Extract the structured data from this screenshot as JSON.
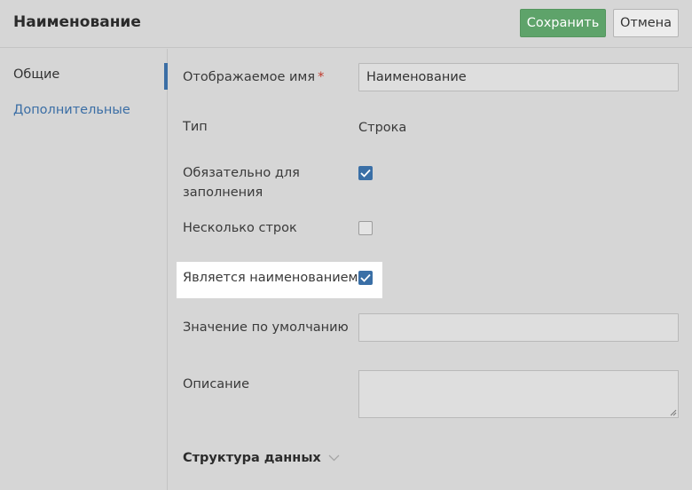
{
  "header": {
    "title": "Наименование",
    "save_label": "Сохранить",
    "cancel_label": "Отмена"
  },
  "sidebar": {
    "items": [
      {
        "label": "Общие",
        "active": true
      },
      {
        "label": "Дополнительные",
        "active": false
      }
    ]
  },
  "form": {
    "display_name": {
      "label": "Отображаемое имя",
      "required_mark": "*",
      "value": "Наименование"
    },
    "type": {
      "label": "Тип",
      "value": "Строка"
    },
    "required": {
      "label_line1": "Обязательно для",
      "label_line2": "заполнения",
      "checked": true
    },
    "multiline": {
      "label": "Несколько строк",
      "checked": false
    },
    "is_name": {
      "label": "Является наименованием",
      "checked": true
    },
    "default_value": {
      "label": "Значение по умолчанию",
      "value": ""
    },
    "description": {
      "label": "Описание",
      "value": ""
    },
    "data_structure": {
      "label": "Структура данных"
    }
  },
  "colors": {
    "accent": "#3b6ea5",
    "save_button": "#5ea36a",
    "required_mark": "#c0392b"
  },
  "icons": [
    "check-icon",
    "chevron-down-icon",
    "resize-grip-icon"
  ]
}
